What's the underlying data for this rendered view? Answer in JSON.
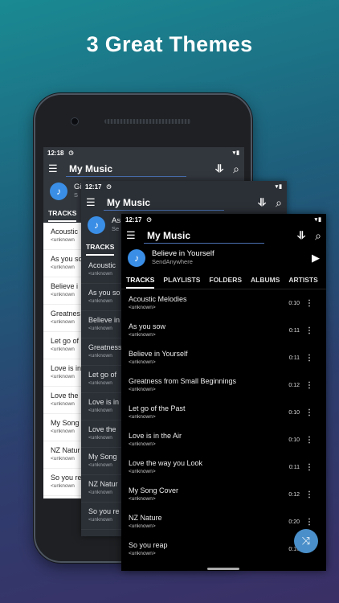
{
  "headline": "3 Great Themes",
  "screens": {
    "light": {
      "time": "12:18",
      "app_title": "My Music",
      "np_title_partial": "Gi",
      "np_artist_partial": "S",
      "tab_active": "TRACKS",
      "tracks": [
        {
          "title": "Acoustic",
          "artist": "<unknown"
        },
        {
          "title": "As you so",
          "artist": "<unknown"
        },
        {
          "title": "Believe i",
          "artist": "<unknown"
        },
        {
          "title": "Greatnes",
          "artist": "<unknown"
        },
        {
          "title": "Let go of",
          "artist": "<unknown"
        },
        {
          "title": "Love is in",
          "artist": "<unknown"
        },
        {
          "title": "Love the",
          "artist": "<unknown"
        },
        {
          "title": "My Song",
          "artist": "<unknown"
        },
        {
          "title": "NZ Natur",
          "artist": "<unknown"
        },
        {
          "title": "So you re",
          "artist": "<unknown"
        }
      ]
    },
    "dark": {
      "time": "12:17",
      "app_title": "My Music",
      "np_title_partial": "As",
      "np_artist_partial": "Se",
      "tab_active": "TRACKS",
      "tracks": [
        {
          "title": "Acoustic",
          "artist": "<unknown"
        },
        {
          "title": "As you so",
          "artist": "<unknown"
        },
        {
          "title": "Believe in",
          "artist": "<unknown"
        },
        {
          "title": "Greatness",
          "artist": "<unknown"
        },
        {
          "title": "Let go of",
          "artist": "<unknown"
        },
        {
          "title": "Love is in",
          "artist": "<unknown"
        },
        {
          "title": "Love the",
          "artist": "<unknown"
        },
        {
          "title": "My Song",
          "artist": "<unknown"
        },
        {
          "title": "NZ Natur",
          "artist": "<unknown"
        },
        {
          "title": "So you re",
          "artist": "<unknown"
        }
      ]
    },
    "black": {
      "time": "12:17",
      "app_title": "My Music",
      "np_title": "Believe in Yourself",
      "np_artist": "SendAnywhere",
      "tabs": [
        "TRACKS",
        "PLAYLISTS",
        "FOLDERS",
        "ALBUMS",
        "ARTISTS",
        "G"
      ],
      "tracks": [
        {
          "title": "Acoustic Melodies",
          "artist": "<unknown>",
          "duration": "0:10"
        },
        {
          "title": "As you sow",
          "artist": "<unknown>",
          "duration": "0:11"
        },
        {
          "title": "Believe in Yourself",
          "artist": "<unknown>",
          "duration": "0:11"
        },
        {
          "title": "Greatness from Small Beginnings",
          "artist": "<unknown>",
          "duration": "0:12"
        },
        {
          "title": "Let go of the Past",
          "artist": "<unknown>",
          "duration": "0:10"
        },
        {
          "title": "Love is in the Air",
          "artist": "<unknown>",
          "duration": "0:10"
        },
        {
          "title": "Love the way you Look",
          "artist": "<unknown>",
          "duration": "0:11"
        },
        {
          "title": "My Song Cover",
          "artist": "<unknown>",
          "duration": "0:12"
        },
        {
          "title": "NZ Nature",
          "artist": "<unknown>",
          "duration": "0:20"
        },
        {
          "title": "So you reap",
          "artist": "<unknown>",
          "duration": "0:10"
        }
      ]
    }
  },
  "icons": {
    "menu": "hamburger-icon",
    "sort": "sort-icon",
    "search": "search-icon",
    "play": "play-icon",
    "more": "more-vert-icon",
    "shuffle": "shuffle-icon",
    "note": "music-note-icon"
  },
  "colors": {
    "accent": "#3a8ee6",
    "fab": "#4a8fc9"
  }
}
